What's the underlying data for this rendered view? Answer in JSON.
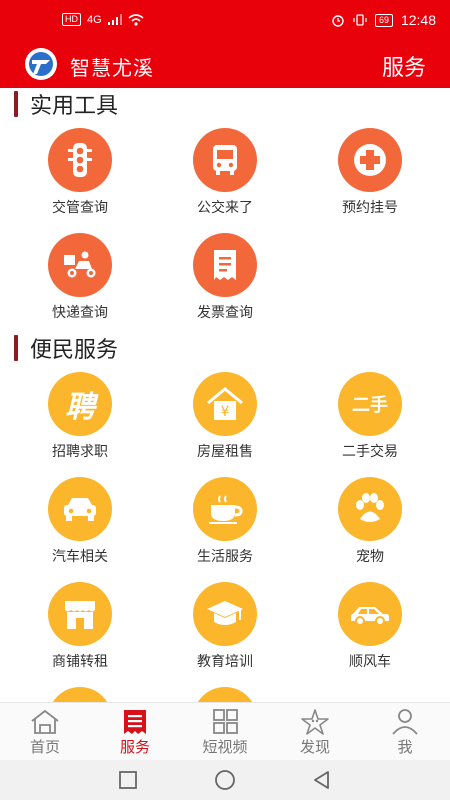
{
  "status_bar": {
    "left_badge": "HD",
    "network": "4G",
    "battery": "69",
    "time": "12:48"
  },
  "app": {
    "title": "智慧尤溪",
    "right_title": "服务"
  },
  "sections": [
    {
      "title": "实用工具",
      "items": [
        {
          "label": "交管查询",
          "icon": "traffic-light-icon"
        },
        {
          "label": "公交来了",
          "icon": "bus-icon"
        },
        {
          "label": "预约挂号",
          "icon": "medical-cross-icon"
        },
        {
          "label": "快递查询",
          "icon": "delivery-scooter-icon"
        },
        {
          "label": "发票查询",
          "icon": "receipt-icon"
        }
      ]
    },
    {
      "title": "便民服务",
      "items": [
        {
          "label": "招聘求职",
          "icon": "hiring-icon",
          "glyph": "聘"
        },
        {
          "label": "房屋租售",
          "icon": "house-icon",
          "glyph": "¥"
        },
        {
          "label": "二手交易",
          "icon": "secondhand-icon",
          "glyph": "二手"
        },
        {
          "label": "汽车相关",
          "icon": "car-icon"
        },
        {
          "label": "生活服务",
          "icon": "coffee-cup-icon"
        },
        {
          "label": "宠物",
          "icon": "paw-icon"
        },
        {
          "label": "商铺转租",
          "icon": "shop-icon"
        },
        {
          "label": "教育培训",
          "icon": "graduation-cap-icon"
        },
        {
          "label": "顺风车",
          "icon": "rideshare-car-icon"
        }
      ]
    }
  ],
  "tabs": [
    {
      "label": "首页",
      "icon": "home-icon",
      "active": false
    },
    {
      "label": "服务",
      "icon": "service-list-icon",
      "active": true
    },
    {
      "label": "短视频",
      "icon": "grid-icon",
      "active": false
    },
    {
      "label": "发现",
      "icon": "starfish-icon",
      "active": false
    },
    {
      "label": "我",
      "icon": "person-icon",
      "active": false
    }
  ],
  "colors": {
    "header_red": "#e8000b",
    "tool_orange": "#f2683b",
    "service_yellow": "#fbb62c",
    "active_tab": "#d8101a"
  }
}
